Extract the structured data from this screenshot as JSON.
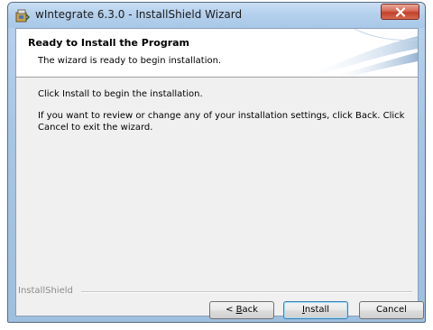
{
  "window": {
    "title": "wIntegrate 6.3.0 - InstallShield Wizard",
    "close_glyph": "x",
    "icon": "installer-app-icon"
  },
  "banner": {
    "title": "Ready to Install the Program",
    "subtitle": "The wizard is ready to begin installation."
  },
  "body": {
    "line1": "Click Install to begin the installation.",
    "line2": "If you want to review or change any of your installation settings, click Back. Click Cancel to exit the wizard."
  },
  "footer": {
    "brand": "InstallShield"
  },
  "buttons": {
    "back": {
      "prefix": "< ",
      "accel": "B",
      "rest": "ack"
    },
    "install": {
      "prefix": "",
      "accel": "I",
      "rest": "nstall"
    },
    "cancel": "Cancel"
  },
  "colors": {
    "frame": "#a9c8e8",
    "close": "#c2412b",
    "client_bg": "#f0f0f0",
    "default_button_border": "#3c7fb1"
  }
}
